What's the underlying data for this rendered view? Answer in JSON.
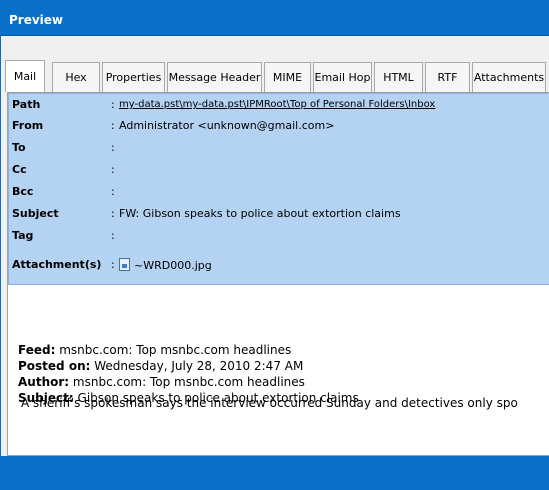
{
  "window": {
    "title": "Preview"
  },
  "tabs": [
    {
      "label": "Mail",
      "active": true
    },
    {
      "label": "Hex"
    },
    {
      "label": "Properties"
    },
    {
      "label": "Message Header"
    },
    {
      "label": "MIME"
    },
    {
      "label": "Email Hop"
    },
    {
      "label": "HTML"
    },
    {
      "label": "RTF"
    },
    {
      "label": "Attachments"
    }
  ],
  "headers": {
    "path": {
      "label": "Path",
      "value": "my-data.pst\\my-data.pst\\IPMRoot\\Top of Personal Folders\\Inbox"
    },
    "from": {
      "label": "From",
      "value": "Administrator <unknown@gmail.com>"
    },
    "to": {
      "label": "To",
      "value": ""
    },
    "cc": {
      "label": "Cc",
      "value": ""
    },
    "bcc": {
      "label": "Bcc",
      "value": ""
    },
    "subject": {
      "label": "Subject",
      "value": "FW: Gibson speaks to police about extortion claims"
    },
    "tag": {
      "label": "Tag",
      "value": ""
    },
    "attachments": {
      "label": "Attachment(s)",
      "file": "~WRD000.jpg"
    },
    "colon": ":"
  },
  "body": {
    "feed_label": "Feed:",
    "feed_value": "msnbc.com: Top msnbc.com headlines",
    "posted_label": "Posted on:",
    "posted_value": "Wednesday, July 28, 2010 2:47 AM",
    "author_label": "Author:",
    "author_value": "msnbc.com: Top msnbc.com headlines",
    "subject_label": "Subject:",
    "subject_value": "Gibson speaks to police about extortion claims",
    "text": "A sheriff's spokesman says the interview occurred Sunday and detectives only spo"
  },
  "colors": {
    "titlebar": "#0a6fc7",
    "header_bg": "#b4d3f3"
  }
}
